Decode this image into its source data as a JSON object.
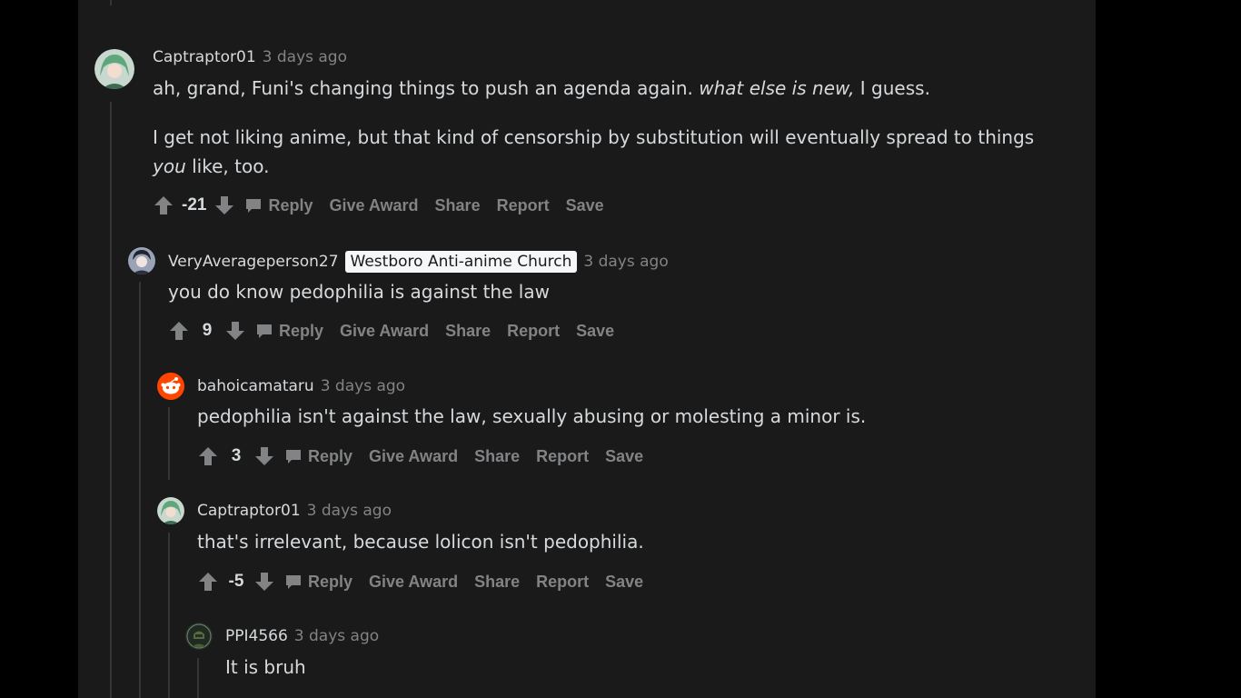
{
  "comments": [
    {
      "username": "Captraptor01",
      "time": "3 days ago",
      "body_p1_before": "ah, grand, Funi's changing things to push an agenda again. ",
      "body_p1_em": "what else is new,",
      "body_p1_after": " I guess.",
      "body_p2_before": "I get not liking anime, but that kind of censorship by substitution will eventually spread to things ",
      "body_p2_em": "you",
      "body_p2_after": " like, too.",
      "score": "-21"
    },
    {
      "username": "VeryAverageperson27",
      "flair": "Westboro Anti-anime Church",
      "time": "3 days ago",
      "body": "you do know pedophilia is against the law",
      "score": "9"
    },
    {
      "username": "bahoicamataru",
      "time": "3 days ago",
      "body": "pedophilia isn't against the law, sexually abusing or molesting a minor is.",
      "score": "3"
    },
    {
      "username": "Captraptor01",
      "time": "3 days ago",
      "body": "that's irrelevant, because lolicon isn't pedophilia.",
      "score": "-5"
    },
    {
      "username": "PPI4566",
      "time": "3 days ago",
      "body": "It is bruh"
    }
  ],
  "actions": {
    "reply": "Reply",
    "give_award": "Give Award",
    "share": "Share",
    "report": "Report",
    "save": "Save"
  },
  "icons": {
    "upvote": "arrow-up-icon",
    "downvote": "arrow-down-icon",
    "reply": "comment-bubble-icon"
  },
  "colors": {
    "background": "#000000",
    "panel": "#1a1a1b",
    "text": "#d7dadc",
    "muted": "#818384",
    "thread_line": "#343536",
    "flair_bg": "#f6f7f8"
  }
}
